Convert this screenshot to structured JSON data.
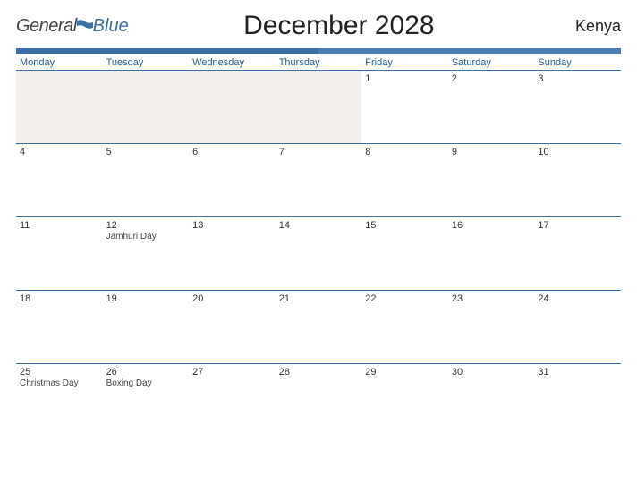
{
  "logo": {
    "text1": "General",
    "text2": "Blue"
  },
  "title": "December 2028",
  "region": "Kenya",
  "weekdays": [
    "Monday",
    "Tuesday",
    "Wednesday",
    "Thursday",
    "Friday",
    "Saturday",
    "Sunday"
  ],
  "weeks": [
    [
      {
        "day": "",
        "holiday": "",
        "empty": true
      },
      {
        "day": "",
        "holiday": "",
        "empty": true
      },
      {
        "day": "",
        "holiday": "",
        "empty": true
      },
      {
        "day": "",
        "holiday": "",
        "empty": true
      },
      {
        "day": "1",
        "holiday": ""
      },
      {
        "day": "2",
        "holiday": ""
      },
      {
        "day": "3",
        "holiday": ""
      }
    ],
    [
      {
        "day": "4",
        "holiday": ""
      },
      {
        "day": "5",
        "holiday": ""
      },
      {
        "day": "6",
        "holiday": ""
      },
      {
        "day": "7",
        "holiday": ""
      },
      {
        "day": "8",
        "holiday": ""
      },
      {
        "day": "9",
        "holiday": ""
      },
      {
        "day": "10",
        "holiday": ""
      }
    ],
    [
      {
        "day": "11",
        "holiday": ""
      },
      {
        "day": "12",
        "holiday": "Jamhuri Day"
      },
      {
        "day": "13",
        "holiday": ""
      },
      {
        "day": "14",
        "holiday": ""
      },
      {
        "day": "15",
        "holiday": ""
      },
      {
        "day": "16",
        "holiday": ""
      },
      {
        "day": "17",
        "holiday": ""
      }
    ],
    [
      {
        "day": "18",
        "holiday": ""
      },
      {
        "day": "19",
        "holiday": ""
      },
      {
        "day": "20",
        "holiday": ""
      },
      {
        "day": "21",
        "holiday": ""
      },
      {
        "day": "22",
        "holiday": ""
      },
      {
        "day": "23",
        "holiday": ""
      },
      {
        "day": "24",
        "holiday": ""
      }
    ],
    [
      {
        "day": "25",
        "holiday": "Christmas Day"
      },
      {
        "day": "26",
        "holiday": "Boxing Day"
      },
      {
        "day": "27",
        "holiday": ""
      },
      {
        "day": "28",
        "holiday": ""
      },
      {
        "day": "29",
        "holiday": ""
      },
      {
        "day": "30",
        "holiday": ""
      },
      {
        "day": "31",
        "holiday": ""
      }
    ]
  ]
}
